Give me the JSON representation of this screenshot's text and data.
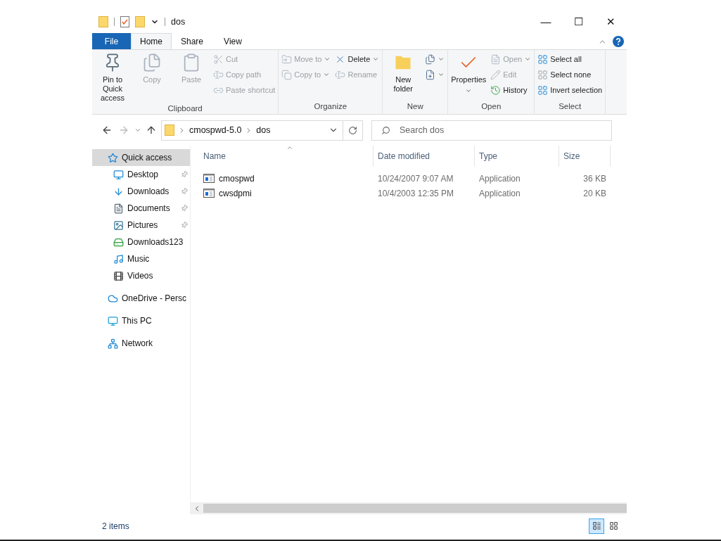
{
  "window": {
    "title": "dos",
    "controls": [
      "—",
      "☐",
      "✕"
    ]
  },
  "tabs": [
    {
      "label": "File",
      "kind": "file",
      "selected": false
    },
    {
      "label": "Home",
      "kind": "tab",
      "selected": true
    },
    {
      "label": "Share",
      "kind": "tab",
      "selected": false
    },
    {
      "label": "View",
      "kind": "tab",
      "selected": false
    }
  ],
  "ribbon": [
    {
      "label": "Clipboard",
      "items": [
        {
          "kind": "large",
          "label": "Pin to Quick access",
          "disabled": false
        },
        {
          "kind": "large",
          "label": "Copy",
          "disabled": true
        },
        {
          "kind": "large",
          "label": "Paste",
          "disabled": true
        },
        {
          "kind": "stack",
          "items": [
            {
              "label": "Cut",
              "disabled": true
            },
            {
              "label": "Copy path",
              "disabled": true
            },
            {
              "label": "Paste shortcut",
              "disabled": true
            }
          ]
        }
      ]
    },
    {
      "label": "Organize",
      "items": [
        {
          "kind": "stack",
          "items": [
            {
              "label": "Move to",
              "disabled": true,
              "dropdown": true
            },
            {
              "label": "Copy to",
              "disabled": true,
              "dropdown": true
            }
          ]
        },
        {
          "kind": "stack",
          "items": [
            {
              "label": "Delete",
              "disabled": false,
              "dropdown": true
            },
            {
              "label": "Rename",
              "disabled": true
            }
          ]
        }
      ]
    },
    {
      "label": "New",
      "items": [
        {
          "kind": "large",
          "label": "New folder",
          "disabled": false
        },
        {
          "kind": "stack",
          "items": [
            {
              "disabled": false,
              "dropdown": true
            },
            {
              "disabled": false,
              "dropdown": true
            }
          ]
        }
      ]
    },
    {
      "label": "Open",
      "items": [
        {
          "kind": "large",
          "label": "Properties",
          "disabled": false,
          "dropdown": true
        },
        {
          "kind": "stack",
          "items": [
            {
              "label": "Open",
              "disabled": true,
              "dropdown": true
            },
            {
              "label": "Edit",
              "disabled": true
            },
            {
              "label": "History",
              "disabled": false
            }
          ]
        }
      ]
    },
    {
      "label": "Select",
      "items": [
        {
          "kind": "stack",
          "items": [
            {
              "label": "Select all",
              "disabled": false
            },
            {
              "label": "Select none",
              "disabled": false
            },
            {
              "label": "Invert selection",
              "disabled": false
            }
          ]
        }
      ]
    }
  ],
  "nav": {
    "back_disabled": false,
    "forward_disabled": true,
    "path": [
      "cmospwd-5.0",
      "dos"
    ],
    "search": {
      "placeholder": "Search dos"
    }
  },
  "sidebar": [
    {
      "label": "Quick access",
      "selected": true,
      "children": [
        {
          "label": "Desktop",
          "pinned": true,
          "selected": false
        },
        {
          "label": "Downloads",
          "pinned": true,
          "selected": false
        },
        {
          "label": "Documents",
          "pinned": true,
          "selected": false
        },
        {
          "label": "Pictures",
          "pinned": true,
          "selected": false
        },
        {
          "label": "Downloads123",
          "pinned": false,
          "selected": false
        },
        {
          "label": "Music",
          "pinned": false,
          "selected": false
        },
        {
          "label": "Videos",
          "pinned": false,
          "selected": false
        }
      ]
    },
    {
      "label": "OneDrive - Persc",
      "selected": false
    },
    {
      "label": "This PC",
      "selected": false
    },
    {
      "label": "Network",
      "selected": false
    }
  ],
  "table": {
    "columns": [
      {
        "label": "Name",
        "sorted": true
      },
      {
        "label": "Date modified",
        "sorted": false
      },
      {
        "label": "Type",
        "sorted": false
      },
      {
        "label": "Size",
        "sorted": false
      }
    ],
    "rows": [
      {
        "name": "cmospwd",
        "date": "10/24/2007 9:07 AM",
        "type": "Application",
        "size": "36 KB"
      },
      {
        "name": "cwsdpmi",
        "date": "10/4/2003 12:35 PM",
        "type": "Application",
        "size": "20 KB"
      }
    ]
  },
  "status_bar": {
    "count": "2 items",
    "views": [
      {
        "kind": "details",
        "selected": true
      },
      {
        "kind": "tiles",
        "selected": false
      }
    ]
  }
}
